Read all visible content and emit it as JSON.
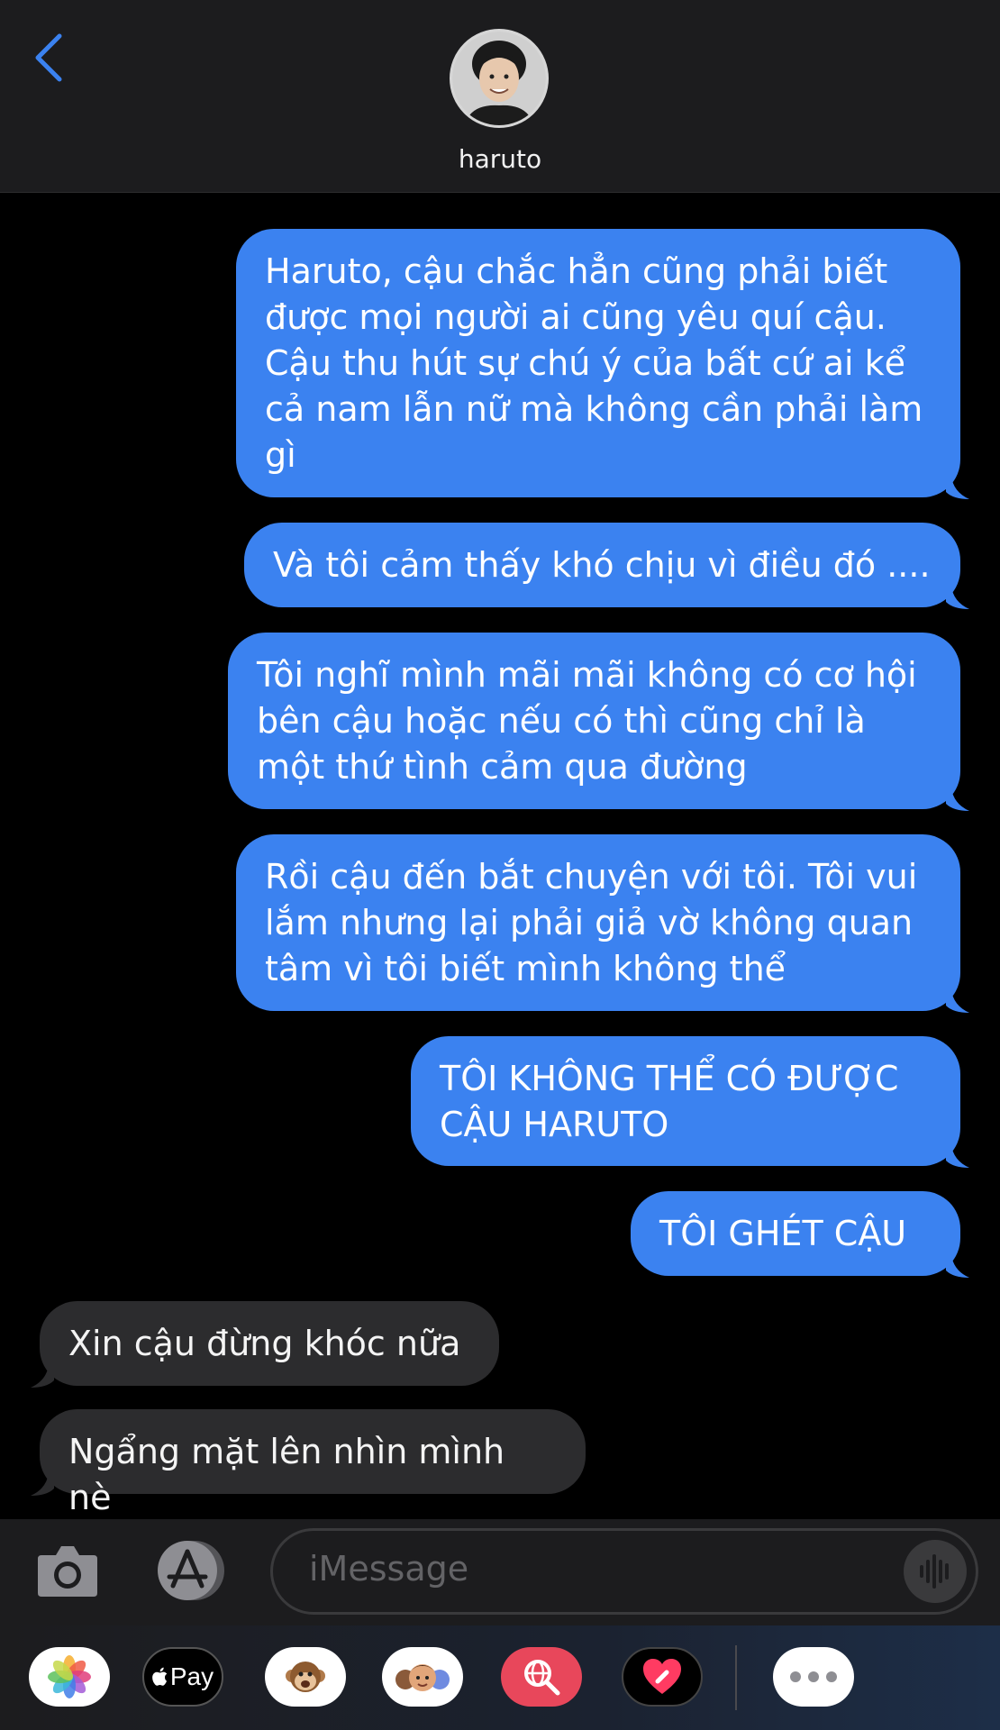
{
  "header": {
    "contact_name": "haruto",
    "back_icon": "chevron-left-icon",
    "accent": "#3b82f0"
  },
  "messages": [
    {
      "from": "me",
      "text": "Haruto, cậu chắc hẳn cũng phải biết\nđược mọi người ai cũng yêu quí cậu.\nCậu thu hút sự chú ý của bất cứ ai kể\ncả nam lẫn nữ mà không cần phải làm\ngì"
    },
    {
      "from": "me",
      "text": "Và tôi cảm thấy khó chịu vì điều đó ...."
    },
    {
      "from": "me",
      "text": "Tôi nghĩ mình mãi mãi không có cơ hội\nbên cậu hoặc nếu có thì cũng chỉ là\nmột thứ tình cảm qua đường"
    },
    {
      "from": "me",
      "text": "Rồi cậu đến bắt chuyện với tôi. Tôi vui\nlắm nhưng lại phải giả vờ không quan\ntâm vì tôi biết mình không thể"
    },
    {
      "from": "me",
      "text": "TÔI KHÔNG THỂ CÓ ĐƯỢC\nCẬU HARUTO"
    },
    {
      "from": "me",
      "text": "TÔI GHÉT CẬU"
    },
    {
      "from": "them",
      "text": "Xin cậu đừng khóc nữa"
    },
    {
      "from": "them",
      "text": "Ngẩng mặt lên nhìn mình nè"
    }
  ],
  "compose": {
    "placeholder": "iMessage",
    "camera_icon": "camera-icon",
    "apps_icon": "app-store-icon",
    "audio_icon": "waveform-icon"
  },
  "app_tray": [
    {
      "name": "photos-icon"
    },
    {
      "name": "apple-pay-icon",
      "label": "Pay"
    },
    {
      "name": "animoji-monkey-icon"
    },
    {
      "name": "memoji-icon"
    },
    {
      "name": "web-search-icon"
    },
    {
      "name": "digital-touch-icon"
    },
    {
      "name": "more-icon"
    }
  ],
  "colors": {
    "sent_bubble": "#3b82f0",
    "received_bubble": "#2c2c2e",
    "background": "#000000"
  }
}
